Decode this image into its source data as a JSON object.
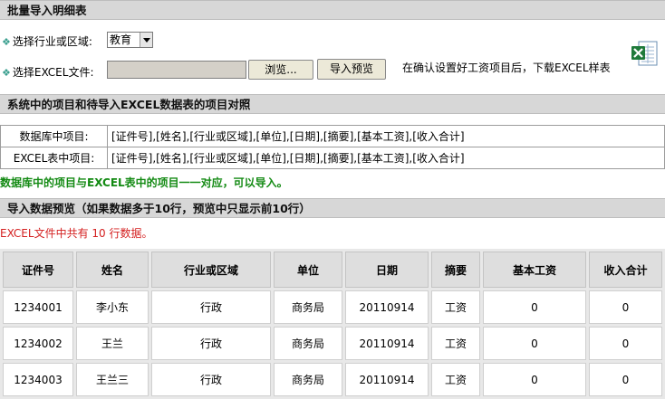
{
  "header": {
    "title": "批量导入明细表"
  },
  "form": {
    "industry_label": "选择行业或区域:",
    "industry_value": "教育",
    "file_label": "选择EXCEL文件:",
    "browse_label": "浏览...",
    "preview_button": "导入预览",
    "download_hint": "在确认设置好工资项目后，下载EXCEL样表"
  },
  "mapping": {
    "title": "系统中的项目和待导入EXCEL数据表的项目对照",
    "rows": [
      {
        "label": "数据库中项目:",
        "value": "[证件号],[姓名],[行业或区域],[单位],[日期],[摘要],[基本工资],[收入合计]"
      },
      {
        "label": "EXCEL表中项目:",
        "value": "[证件号],[姓名],[行业或区域],[单位],[日期],[摘要],[基本工资],[收入合计]"
      }
    ],
    "note": "数据库中的项目与EXCEL表中的项目一一对应，可以导入。"
  },
  "preview": {
    "title": "导入数据预览（如果数据多于10行，预览中只显示前10行）",
    "count_prefix": "EXCEL文件中共有",
    "count_value": "10",
    "count_suffix": "行数据。",
    "columns": [
      "证件号",
      "姓名",
      "行业或区域",
      "单位",
      "日期",
      "摘要",
      "基本工资",
      "收入合计"
    ],
    "rows": [
      [
        "1234001",
        "李小东",
        "行政",
        "商务局",
        "20110914",
        "工资",
        "0",
        "0"
      ],
      [
        "1234002",
        "王兰",
        "行政",
        "商务局",
        "20110914",
        "工资",
        "0",
        "0"
      ],
      [
        "1234003",
        "王兰三",
        "行政",
        "商务局",
        "20110914",
        "工资",
        "0",
        "0"
      ]
    ]
  }
}
